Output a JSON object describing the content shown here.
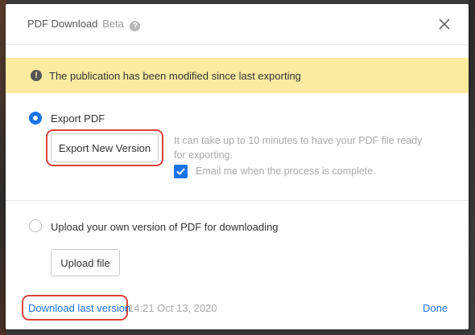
{
  "header": {
    "title": "PDF Download",
    "beta_label": "Beta",
    "help_icon": "help-icon",
    "close_icon": "close-icon"
  },
  "banner": {
    "icon": "warning-icon",
    "text": "The publication has been modified since last exporting"
  },
  "export_option": {
    "label": "Export PDF",
    "selected": true,
    "button_label": "Export New Version",
    "hint": "It can take up to 10 minutes to have your PDF file ready for exporting.",
    "email_checkbox_label": "Email me when the process is complete.",
    "email_checked": true
  },
  "upload_option": {
    "label": "Upload your own version of PDF for downloading",
    "selected": false,
    "button_label": "Upload file"
  },
  "footer": {
    "download_link": "Download last version",
    "timestamp": "14:21 Oct 13, 2020",
    "done_label": "Done"
  },
  "colors": {
    "accent": "#1a73e8",
    "banner_bg": "#fbeba0",
    "highlight": "#d9443a"
  }
}
